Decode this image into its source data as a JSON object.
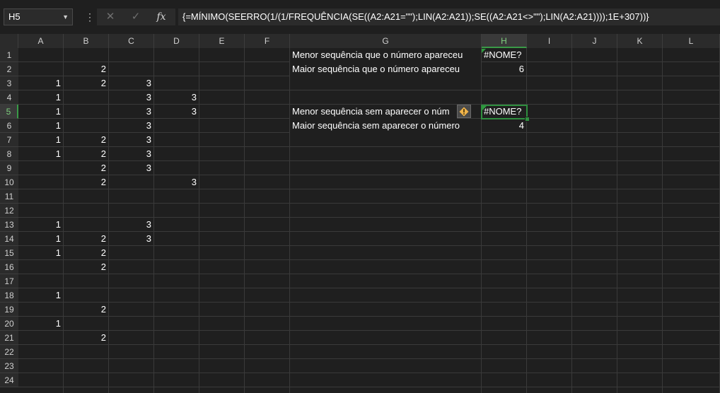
{
  "formula_bar": {
    "name_box": "H5",
    "formula": "{=MÍNIMO(SEERRO(1/(1/FREQUÊNCIA(SE((A2:A21=\"\");LIN(A2:A21));SE((A2:A21<>\"\");LIN(A2:A21))));1E+307))}",
    "fx_label": "fx"
  },
  "columns": [
    "A",
    "B",
    "C",
    "D",
    "E",
    "F",
    "G",
    "H",
    "I",
    "J",
    "K",
    "L"
  ],
  "rows": [
    "1",
    "2",
    "3",
    "4",
    "5",
    "6",
    "7",
    "8",
    "9",
    "10",
    "11",
    "12",
    "13",
    "14",
    "15",
    "16",
    "17",
    "18",
    "19",
    "20",
    "21",
    "22",
    "23",
    "24"
  ],
  "cells": {
    "B2": "2",
    "A3": "1",
    "B3": "2",
    "C3": "3",
    "A4": "1",
    "C4": "3",
    "D4": "3",
    "A5": "1",
    "C5": "3",
    "D5": "3",
    "A6": "1",
    "C6": "3",
    "A7": "1",
    "B7": "2",
    "C7": "3",
    "A8": "1",
    "B8": "2",
    "C8": "3",
    "B9": "2",
    "C9": "3",
    "B10": "2",
    "D10": "3",
    "A13": "1",
    "C13": "3",
    "A14": "1",
    "B14": "2",
    "C14": "3",
    "A15": "1",
    "B15": "2",
    "B16": "2",
    "A18": "1",
    "B19": "2",
    "A20": "1",
    "B21": "2",
    "G1": "Menor sequência que o número apareceu",
    "H1": "#NOME?",
    "G2": "Maior sequência que o número apareceu",
    "H2": "6",
    "G5": "Menor sequência sem aparecer o núm",
    "H5": "#NOME?",
    "G6": "Maior sequência sem aparecer o número",
    "H6": "4"
  },
  "selection": {
    "active_cell": "H5",
    "column": "H",
    "row": "5"
  },
  "colors": {
    "background": "#1f1f1f",
    "header": "#2b2b2b",
    "accent": "#2f8f3f",
    "warning": "#f0b44a"
  },
  "icons": {
    "cancel": "close-icon",
    "enter": "check-icon",
    "function": "fx-icon",
    "error_indicator": "warning-icon",
    "name_box_dropdown": "chevron-down-icon"
  }
}
